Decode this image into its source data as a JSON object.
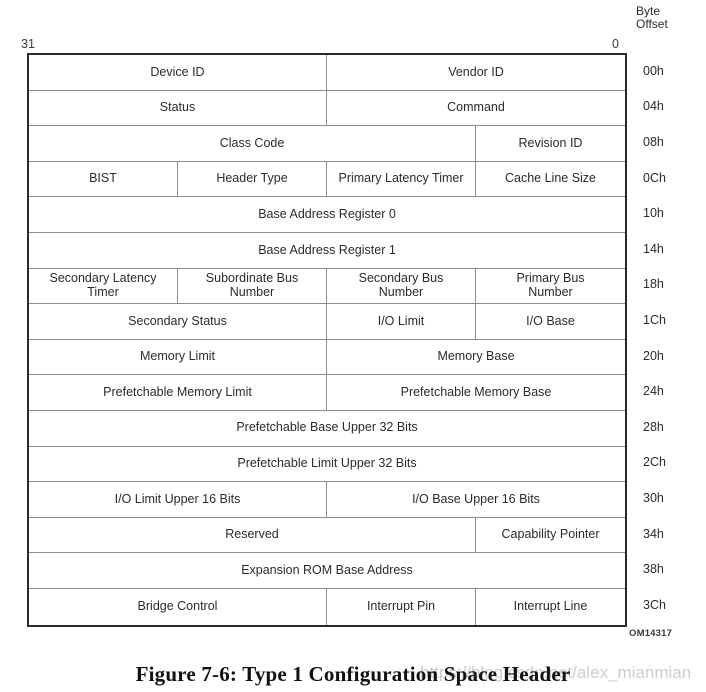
{
  "bit_labels": {
    "high": "31",
    "low": "0"
  },
  "byte_offset_header": {
    "line1": "Byte",
    "line2": "Offset"
  },
  "figure": {
    "id": "OM14317",
    "caption": "Figure 7-6:  Type 1 Configuration Space Header",
    "watermark": "https://blog.csdn.net/alex_mianmian"
  },
  "table": {
    "rows": [
      {
        "offset": "00h",
        "cells": [
          {
            "label": "Device ID",
            "span": 2
          },
          {
            "label": "Vendor ID",
            "span": 2
          }
        ]
      },
      {
        "offset": "04h",
        "cells": [
          {
            "label": "Status",
            "span": 2
          },
          {
            "label": "Command",
            "span": 2
          }
        ]
      },
      {
        "offset": "08h",
        "cells": [
          {
            "label": "Class Code",
            "span": 3
          },
          {
            "label": "Revision ID",
            "span": 1
          }
        ]
      },
      {
        "offset": "0Ch",
        "cells": [
          {
            "label": "BIST",
            "span": 1
          },
          {
            "label": "Header Type",
            "span": 1
          },
          {
            "label": "Primary Latency Timer",
            "span": 1
          },
          {
            "label": "Cache Line Size",
            "span": 1
          }
        ]
      },
      {
        "offset": "10h",
        "cells": [
          {
            "label": "Base Address Register 0",
            "span": 4
          }
        ]
      },
      {
        "offset": "14h",
        "cells": [
          {
            "label": "Base Address Register 1",
            "span": 4
          }
        ]
      },
      {
        "offset": "18h",
        "cells": [
          {
            "label": "Secondary Latency\nTimer",
            "span": 1
          },
          {
            "label": "Subordinate Bus\nNumber",
            "span": 1
          },
          {
            "label": "Secondary Bus\nNumber",
            "span": 1
          },
          {
            "label": "Primary Bus\nNumber",
            "span": 1
          }
        ]
      },
      {
        "offset": "1Ch",
        "cells": [
          {
            "label": "Secondary Status",
            "span": 2
          },
          {
            "label": "I/O Limit",
            "span": 1
          },
          {
            "label": "I/O Base",
            "span": 1
          }
        ]
      },
      {
        "offset": "20h",
        "cells": [
          {
            "label": "Memory Limit",
            "span": 2
          },
          {
            "label": "Memory Base",
            "span": 2
          }
        ]
      },
      {
        "offset": "24h",
        "cells": [
          {
            "label": "Prefetchable Memory Limit",
            "span": 2
          },
          {
            "label": "Prefetchable Memory Base",
            "span": 2
          }
        ]
      },
      {
        "offset": "28h",
        "cells": [
          {
            "label": "Prefetchable Base Upper 32 Bits",
            "span": 4
          }
        ]
      },
      {
        "offset": "2Ch",
        "cells": [
          {
            "label": "Prefetchable Limit Upper 32 Bits",
            "span": 4
          }
        ]
      },
      {
        "offset": "30h",
        "cells": [
          {
            "label": "I/O Limit Upper 16 Bits",
            "span": 2
          },
          {
            "label": "I/O Base Upper 16 Bits",
            "span": 2
          }
        ]
      },
      {
        "offset": "34h",
        "cells": [
          {
            "label": "Reserved",
            "span": 3
          },
          {
            "label": "Capability Pointer",
            "span": 1
          }
        ]
      },
      {
        "offset": "38h",
        "cells": [
          {
            "label": "Expansion ROM Base Address",
            "span": 4
          }
        ]
      },
      {
        "offset": "3Ch",
        "cells": [
          {
            "label": "Bridge Control",
            "span": 2
          },
          {
            "label": "Interrupt Pin",
            "span": 1
          },
          {
            "label": "Interrupt Line",
            "span": 1
          }
        ]
      }
    ]
  }
}
